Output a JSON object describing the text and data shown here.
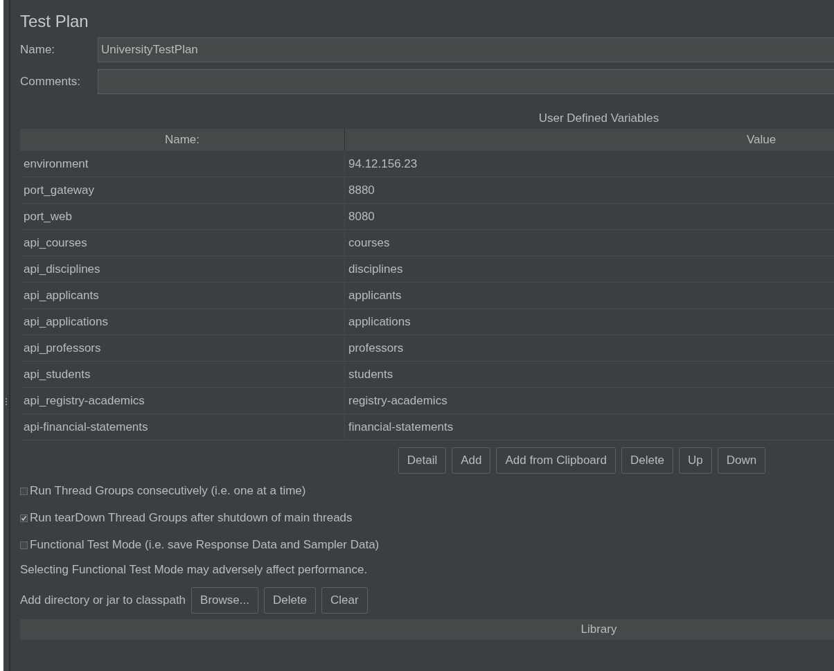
{
  "title": "Test Plan",
  "name_field": {
    "label": "Name:",
    "value": "UniversityTestPlan"
  },
  "comments_field": {
    "label": "Comments:"
  },
  "variables": {
    "title": "User Defined Variables",
    "columns": [
      "Name:",
      "Value"
    ],
    "rows": [
      {
        "name": "environment",
        "value": "94.12.156.23"
      },
      {
        "name": "port_gateway",
        "value": "8880"
      },
      {
        "name": "port_web",
        "value": "8080"
      },
      {
        "name": "api_courses",
        "value": "courses"
      },
      {
        "name": "api_disciplines",
        "value": "disciplines"
      },
      {
        "name": "api_applicants",
        "value": "applicants"
      },
      {
        "name": "api_applications",
        "value": "applications"
      },
      {
        "name": "api_professors",
        "value": "professors"
      },
      {
        "name": "api_students",
        "value": "students"
      },
      {
        "name": "api_registry-academics",
        "value": "registry-academics"
      },
      {
        "name": "api-financial-statements",
        "value": "financial-statements"
      }
    ],
    "buttons": [
      "Detail",
      "Add",
      "Add from Clipboard",
      "Delete",
      "Up",
      "Down"
    ]
  },
  "options": [
    {
      "label": "Run Thread Groups consecutively (i.e. one at a time)",
      "checked": false
    },
    {
      "label": "Run tearDown Thread Groups after shutdown of main threads",
      "checked": true
    },
    {
      "label": "Functional Test Mode (i.e. save Response Data and Sampler Data)",
      "checked": false
    }
  ],
  "note": "Selecting Functional Test Mode may adversely affect performance.",
  "classpath": {
    "label": "Add directory or jar to classpath",
    "buttons": [
      "Browse...",
      "Delete",
      "Clear"
    ]
  },
  "library": {
    "columns": [
      "Library"
    ]
  }
}
